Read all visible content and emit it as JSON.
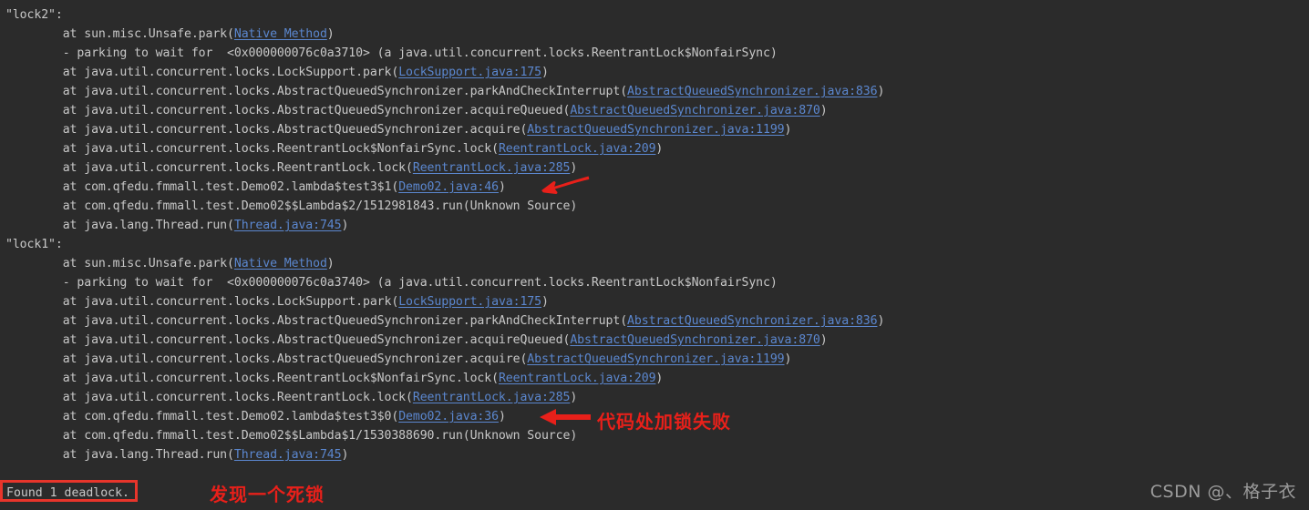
{
  "console": {
    "background_color": "#2b2b2b",
    "text_color": "#c8c8c8",
    "link_color": "#5b87cf",
    "annotation_color": "#e8201a",
    "lines": [
      {
        "id": 0,
        "text": "\"lock2\":"
      },
      {
        "id": 1,
        "pre": "        at sun.misc.Unsafe.park(",
        "link": "Native Method",
        "post": ")"
      },
      {
        "id": 2,
        "text": "        - parking to wait for  <0x000000076c0a3710> (a java.util.concurrent.locks.ReentrantLock$NonfairSync)"
      },
      {
        "id": 3,
        "pre": "        at java.util.concurrent.locks.LockSupport.park(",
        "link": "LockSupport.java:175",
        "post": ")"
      },
      {
        "id": 4,
        "pre": "        at java.util.concurrent.locks.AbstractQueuedSynchronizer.parkAndCheckInterrupt(",
        "link": "AbstractQueuedSynchronizer.java:836",
        "post": ")"
      },
      {
        "id": 5,
        "pre": "        at java.util.concurrent.locks.AbstractQueuedSynchronizer.acquireQueued(",
        "link": "AbstractQueuedSynchronizer.java:870",
        "post": ")"
      },
      {
        "id": 6,
        "pre": "        at java.util.concurrent.locks.AbstractQueuedSynchronizer.acquire(",
        "link": "AbstractQueuedSynchronizer.java:1199",
        "post": ")"
      },
      {
        "id": 7,
        "pre": "        at java.util.concurrent.locks.ReentrantLock$NonfairSync.lock(",
        "link": "ReentrantLock.java:209",
        "post": ")"
      },
      {
        "id": 8,
        "pre": "        at java.util.concurrent.locks.ReentrantLock.lock(",
        "link": "ReentrantLock.java:285",
        "post": ")"
      },
      {
        "id": 9,
        "pre": "        at com.qfedu.fmmall.test.Demo02.lambda$test3$1(",
        "link": "Demo02.java:46",
        "post": ")"
      },
      {
        "id": 10,
        "text": "        at com.qfedu.fmmall.test.Demo02$$Lambda$2/1512981843.run(Unknown Source)"
      },
      {
        "id": 11,
        "pre": "        at java.lang.Thread.run(",
        "link": "Thread.java:745",
        "post": ")"
      },
      {
        "id": 12,
        "text": "\"lock1\":"
      },
      {
        "id": 13,
        "pre": "        at sun.misc.Unsafe.park(",
        "link": "Native Method",
        "post": ")"
      },
      {
        "id": 14,
        "text": "        - parking to wait for  <0x000000076c0a3740> (a java.util.concurrent.locks.ReentrantLock$NonfairSync)"
      },
      {
        "id": 15,
        "pre": "        at java.util.concurrent.locks.LockSupport.park(",
        "link": "LockSupport.java:175",
        "post": ")"
      },
      {
        "id": 16,
        "pre": "        at java.util.concurrent.locks.AbstractQueuedSynchronizer.parkAndCheckInterrupt(",
        "link": "AbstractQueuedSynchronizer.java:836",
        "post": ")"
      },
      {
        "id": 17,
        "pre": "        at java.util.concurrent.locks.AbstractQueuedSynchronizer.acquireQueued(",
        "link": "AbstractQueuedSynchronizer.java:870",
        "post": ")"
      },
      {
        "id": 18,
        "pre": "        at java.util.concurrent.locks.AbstractQueuedSynchronizer.acquire(",
        "link": "AbstractQueuedSynchronizer.java:1199",
        "post": ")"
      },
      {
        "id": 19,
        "pre": "        at java.util.concurrent.locks.ReentrantLock$NonfairSync.lock(",
        "link": "ReentrantLock.java:209",
        "post": ")"
      },
      {
        "id": 20,
        "pre": "        at java.util.concurrent.locks.ReentrantLock.lock(",
        "link": "ReentrantLock.java:285",
        "post": ")"
      },
      {
        "id": 21,
        "pre": "        at com.qfedu.fmmall.test.Demo02.lambda$test3$0(",
        "link": "Demo02.java:36",
        "post": ")"
      },
      {
        "id": 22,
        "text": "        at com.qfedu.fmmall.test.Demo02$$Lambda$1/1530388690.run(Unknown Source)"
      },
      {
        "id": 23,
        "pre": "        at java.lang.Thread.run(",
        "link": "Thread.java:745",
        "post": ")"
      },
      {
        "id": 24,
        "text": ""
      }
    ],
    "deadlock_summary": "Found 1 deadlock."
  },
  "annotations": {
    "arrow_top": {
      "name": "red-arrow-pointing-to-demo02-line-46"
    },
    "arrow_bottom": {
      "name": "red-arrow-pointing-to-demo02-line-36"
    },
    "label_lock_failure": "代码处加锁失败",
    "label_deadlock_found": "发现一个死锁"
  },
  "watermark": {
    "text": "CSDN @、格子衣"
  }
}
